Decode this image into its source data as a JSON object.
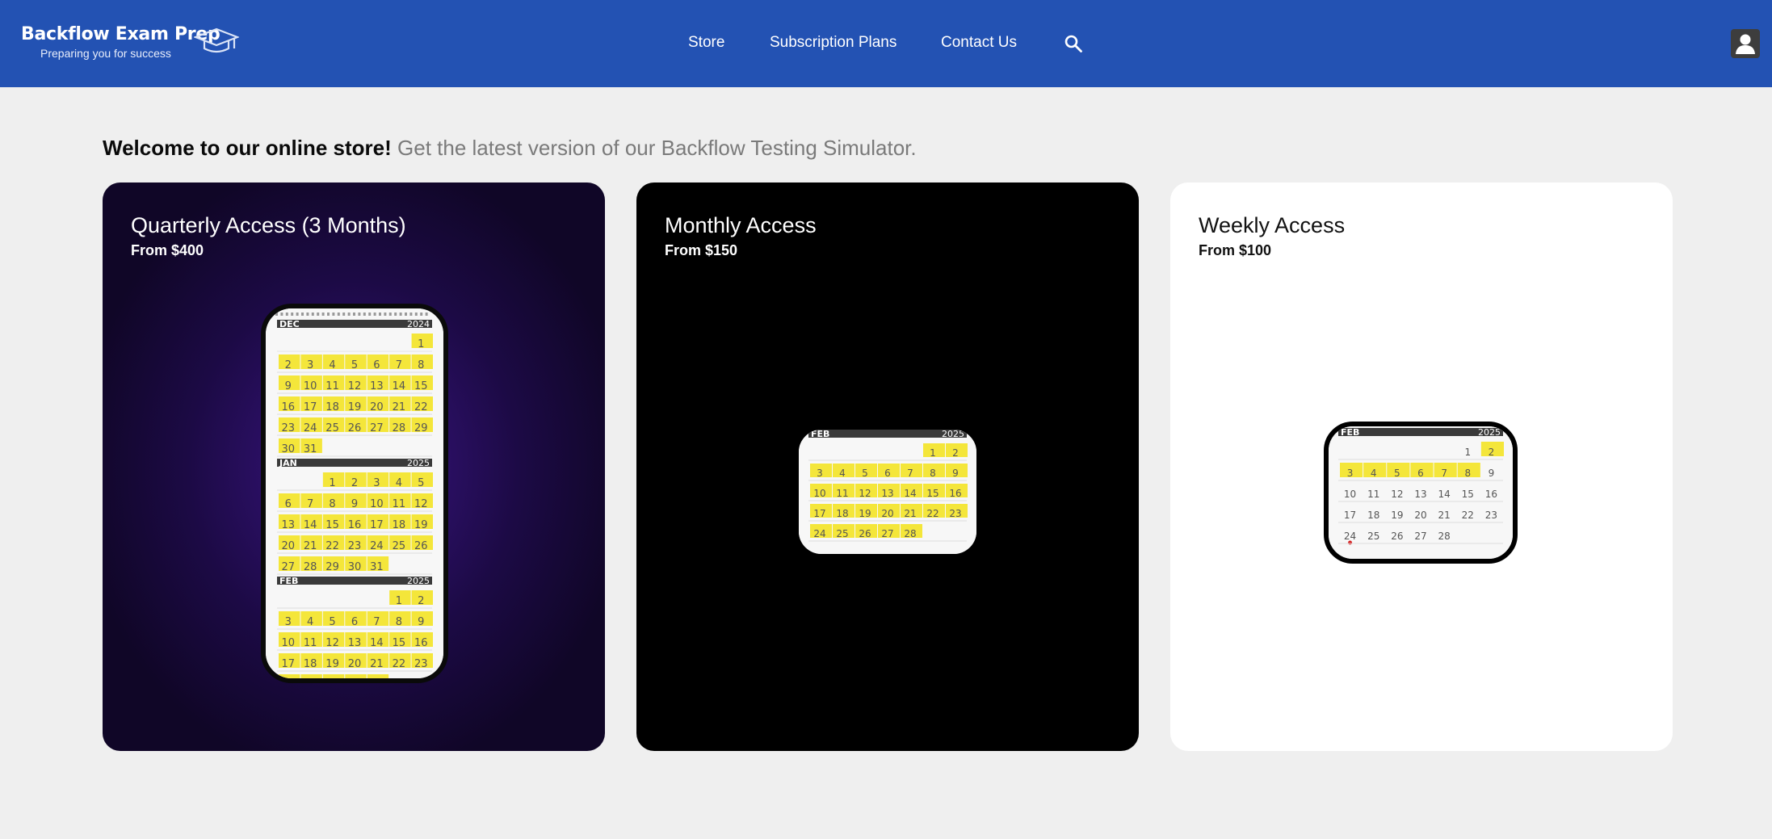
{
  "header": {
    "logo_title": "Backflow Exam Prep",
    "logo_tagline": "Preparing you for success",
    "nav": [
      "Store",
      "Subscription Plans",
      "Contact Us"
    ],
    "search_icon": "search-icon",
    "user_icon": "user-icon",
    "background_color": "#2352b3"
  },
  "welcome": {
    "bold": "Welcome to our online store!",
    "rest": "Get the latest version of our Backflow Testing Simulator."
  },
  "products": [
    {
      "title": "Quarterly Access (3 Months)",
      "price": "From $400"
    },
    {
      "title": "Monthly Access",
      "price": "From $150"
    },
    {
      "title": "Weekly Access",
      "price": "From $100"
    }
  ],
  "calendars": {
    "quarterly": [
      {
        "month": "DEC",
        "year": "2024"
      },
      {
        "month": "JAN",
        "year": "2025"
      },
      {
        "month": "FEB",
        "year": "2025"
      }
    ],
    "monthly": [
      {
        "month": "FEB",
        "year": "2025"
      }
    ],
    "weekly": [
      {
        "month": "FEB",
        "year": "2025"
      }
    ]
  },
  "colors": {
    "highlight": "#f4e63a",
    "marker": "#d61f1f"
  }
}
